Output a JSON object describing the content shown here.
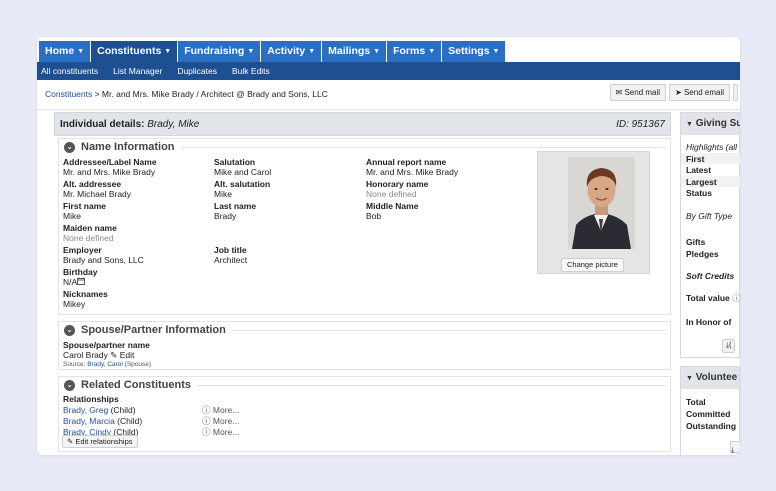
{
  "nav": {
    "tabs": [
      {
        "label": "Home"
      },
      {
        "label": "Constituents"
      },
      {
        "label": "Fundraising"
      },
      {
        "label": "Activity"
      },
      {
        "label": "Mailings"
      },
      {
        "label": "Forms"
      },
      {
        "label": "Settings"
      }
    ],
    "subnav": [
      "All constituents",
      "List Manager",
      "Duplicates",
      "Bulk Edits"
    ]
  },
  "breadcrumb": {
    "link": "Constituents",
    "rest": " > Mr. and Mrs. Mike Brady / Architect @ Brady and Sons, LLC"
  },
  "actions": {
    "send_mail": "Send mail",
    "send_email": "Send email"
  },
  "details": {
    "title": "Individual details:",
    "name": "Brady, Mike",
    "id": "ID: 951367"
  },
  "name_info": {
    "title": "Name Information",
    "addressee_label": "Addressee/Label Name",
    "addressee_value": "Mr. and Mrs. Mike Brady",
    "salutation_label": "Salutation",
    "salutation_value": "Mike and Carol",
    "annual_label": "Annual report name",
    "annual_value": "Mr. and Mrs. Mike Brady",
    "alt_addressee_label": "Alt. addressee",
    "alt_addressee_value": "Mr. Michael Brady",
    "alt_salutation_label": "Alt. salutation",
    "alt_salutation_value": "Mike",
    "honorary_label": "Honorary name",
    "honorary_value": "None defined",
    "first_label": "First name",
    "first_value": "Mike",
    "last_label": "Last name",
    "last_value": "Brady",
    "middle_label": "Middle Name",
    "middle_value": "Bob",
    "maiden_label": "Maiden name",
    "maiden_value": "None defined",
    "employer_label": "Employer",
    "employer_value": "Brady and Sons, LLC",
    "job_label": "Job title",
    "job_value": "Architect",
    "birthday_label": "Birthday",
    "birthday_value": "N/A",
    "nick_label": "Nicknames",
    "nick_value": "Mikey",
    "change_picture": "Change picture"
  },
  "spouse": {
    "title": "Spouse/Partner Information",
    "label": "Spouse/partner name",
    "value": "Carol Brady",
    "edit": "Edit",
    "source_prefix": "Source: ",
    "source_link": "Brady, Carol",
    "source_suffix": " (Spouse)"
  },
  "related": {
    "title": "Related Constituents",
    "label": "Relationships",
    "items": [
      {
        "name": "Brady, Greg",
        "rel": " (Child)",
        "more": "More..."
      },
      {
        "name": "Brady, Marcia",
        "rel": " (Child)",
        "more": "More..."
      },
      {
        "name": "Brady, Cindy",
        "rel": " (Child)",
        "more": "More..."
      }
    ],
    "edit": "Edit relationships"
  },
  "giving": {
    "title": "Giving Su",
    "highlights": "Highlights (all",
    "first": "First",
    "latest": "Latest",
    "largest": "Largest",
    "status": "Status",
    "by_gift_type": "By Gift Type",
    "gifts": "Gifts",
    "pledges": "Pledges",
    "soft_credits": "Soft Credits",
    "total_value": "Total value",
    "in_honor": "In Honor of",
    "btn": "("
  },
  "volunteer": {
    "title": "Voluntee",
    "total": "Total",
    "committed": "Committed",
    "outstanding": "Outstanding"
  }
}
